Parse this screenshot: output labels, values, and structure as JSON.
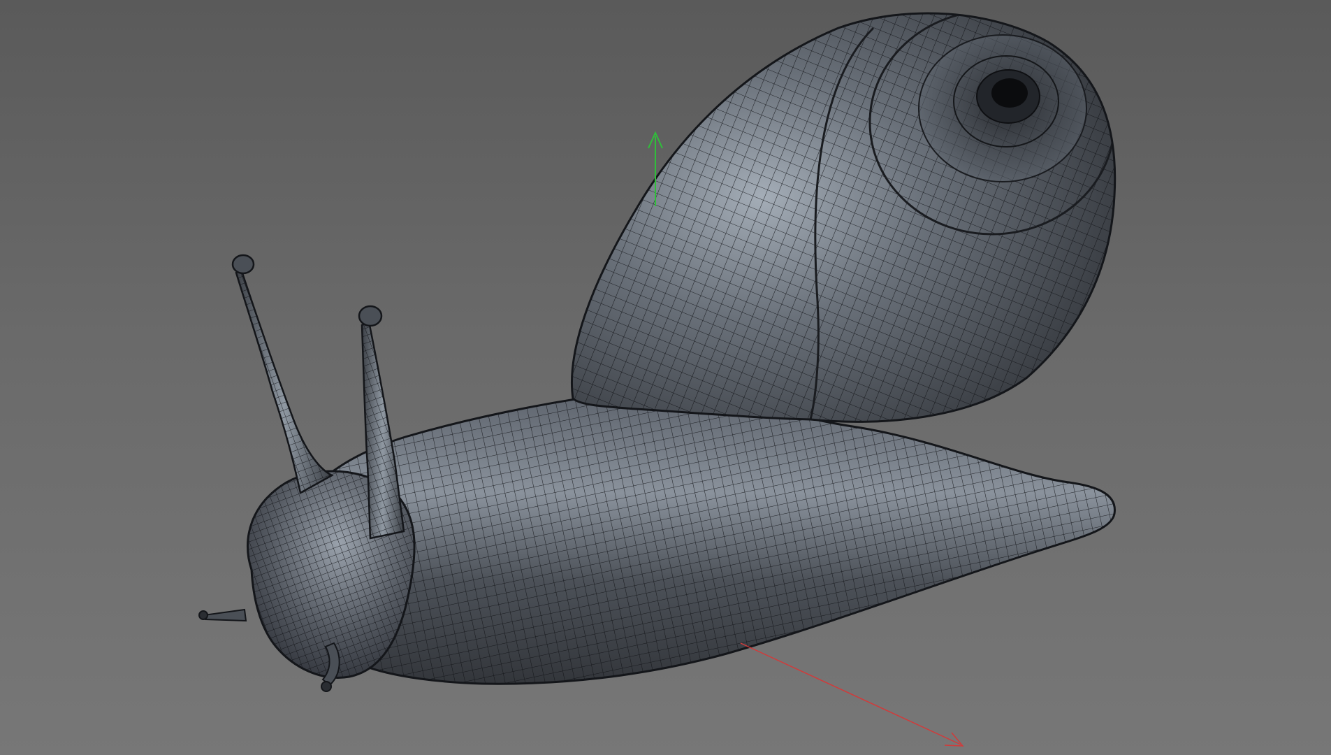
{
  "viewport": {
    "background_top": "#5a5a5a",
    "background_bottom": "#777777"
  },
  "model": {
    "subject": "snail",
    "display_mode": "wireframe-on-shaded",
    "surface_color": "#3c4046",
    "wire_color": "#0f1114",
    "highlight_color": "#8d96a3"
  },
  "gizmo": {
    "y_axis_color": "#2fbf3a",
    "x_axis_color": "#d23a3a",
    "y_axis_icon": "arrow-up-icon",
    "x_axis_icon": "arrow-right-icon"
  }
}
